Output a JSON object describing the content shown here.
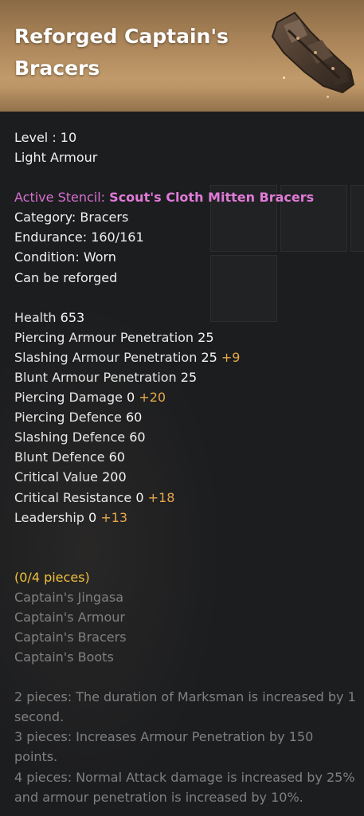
{
  "item": {
    "title": "Reforged Captain's Bracers",
    "title_line1": "Reforged Captain's",
    "title_line2": "Bracers",
    "icon": "leather-bracers-icon"
  },
  "info": {
    "level": "Level : 10",
    "type": "Light Armour",
    "stencil_label": "Active Stencil:",
    "stencil_name": "Scout's Cloth Mitten Bracers",
    "category": "Category: Bracers",
    "endurance": "Endurance: 160/161",
    "condition": "Condition: Worn",
    "reforge": "Can be reforged"
  },
  "stats": [
    {
      "name": "Health",
      "value": "653",
      "bonus": ""
    },
    {
      "name": "Piercing Armour Penetration",
      "value": "25",
      "bonus": ""
    },
    {
      "name": "Slashing Armour Penetration",
      "value": "25",
      "bonus": "+9"
    },
    {
      "name": "Blunt Armour Penetration",
      "value": "25",
      "bonus": ""
    },
    {
      "name": "Piercing Damage",
      "value": "0",
      "bonus": "+20"
    },
    {
      "name": "Piercing Defence",
      "value": "60",
      "bonus": ""
    },
    {
      "name": "Slashing Defence",
      "value": "60",
      "bonus": ""
    },
    {
      "name": "Blunt Defence",
      "value": "60",
      "bonus": ""
    },
    {
      "name": "Critical Value",
      "value": "200",
      "bonus": ""
    },
    {
      "name": "Critical Resistance",
      "value": "0",
      "bonus": "+18"
    },
    {
      "name": "Leadership",
      "value": "0",
      "bonus": "+13"
    }
  ],
  "set": {
    "progress": "(0/4 pieces)",
    "pieces": [
      "Captain's Jingasa",
      "Captain's Armour",
      "Captain's Bracers",
      "Captain's Boots"
    ],
    "bonuses": [
      "2 pieces: The duration of Marksman is increased by 1 second.",
      "3 pieces: Increases Armour Penetration by 150 points.",
      "4 pieces: Normal Attack damage is increased by 25% and armour penetration is increased by 10%."
    ]
  },
  "colors": {
    "header_gold": "#b08a5d",
    "stencil_pink": "#e07ad8",
    "bonus_orange": "#e6a84c",
    "set_gold": "#f0c13a",
    "inactive_grey": "#808080"
  }
}
